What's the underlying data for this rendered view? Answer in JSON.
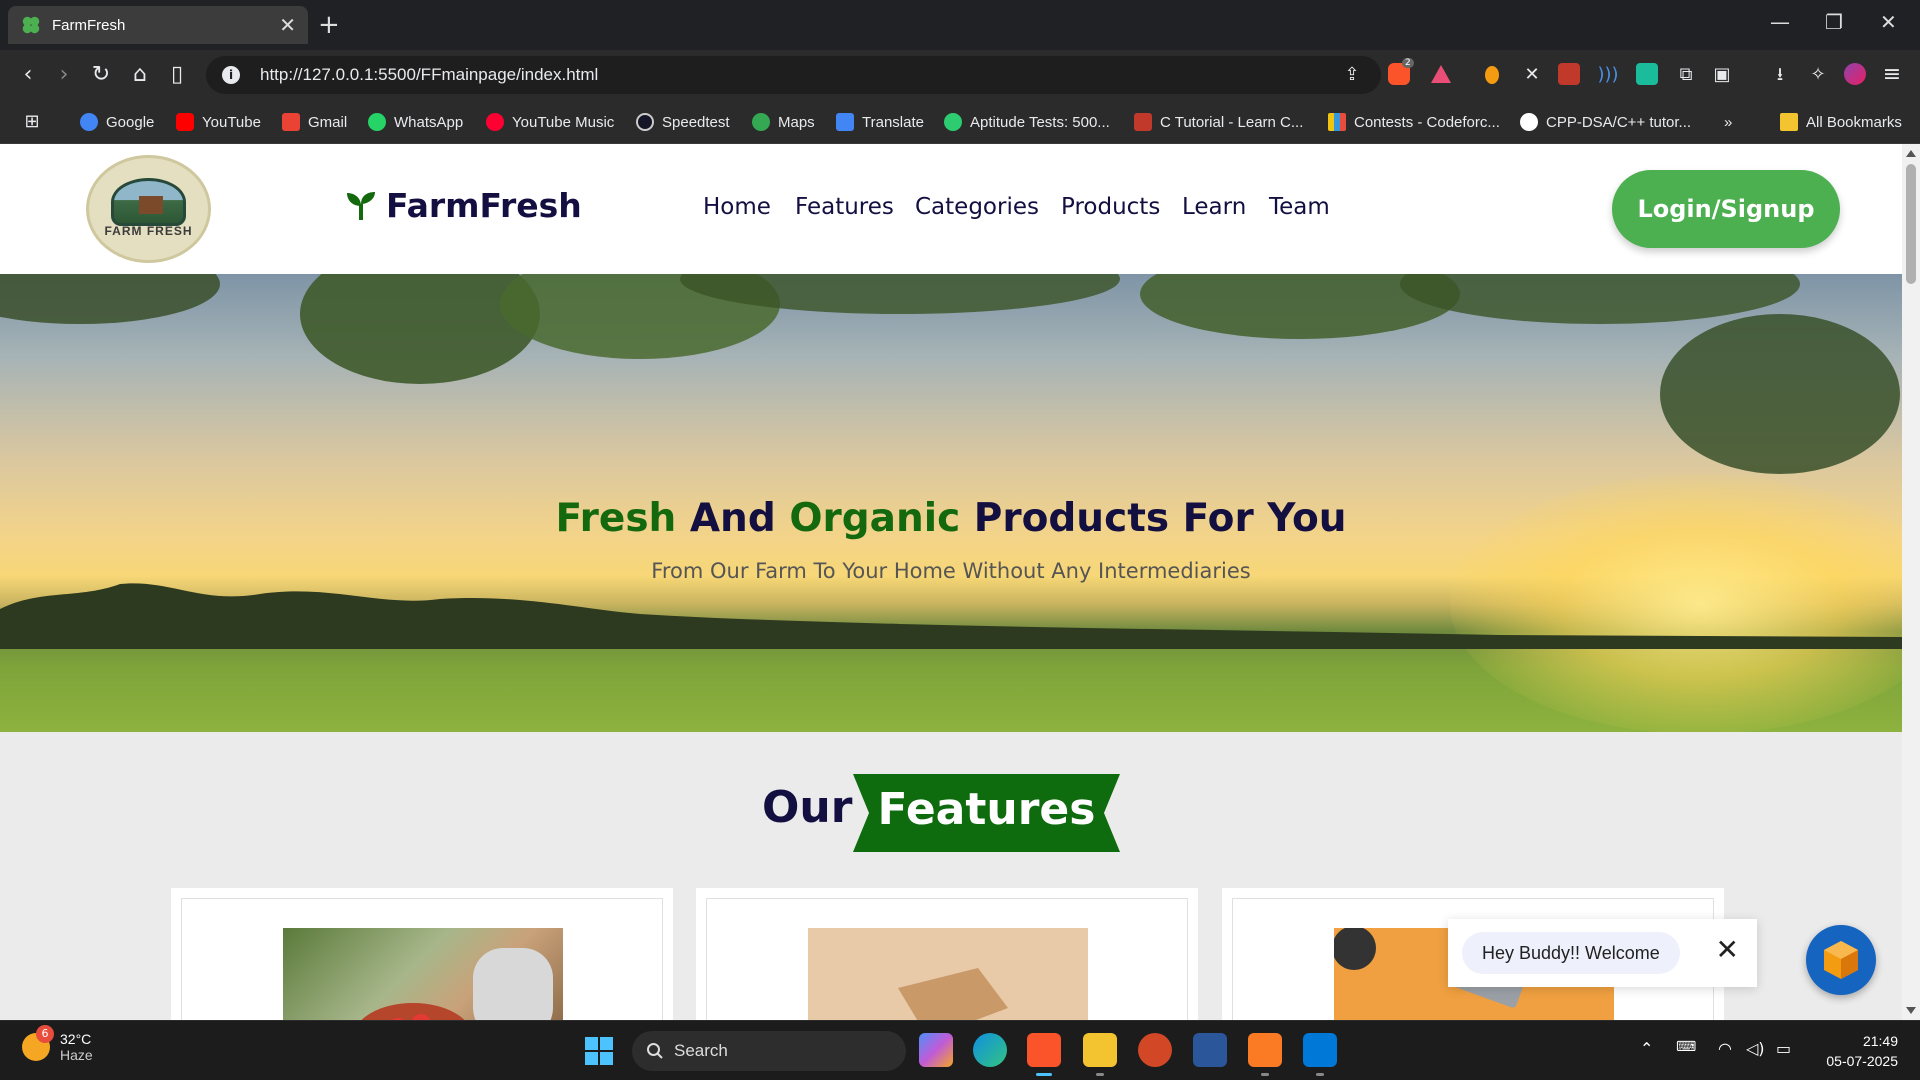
{
  "browser": {
    "tab_title": "FarmFresh",
    "url": "http://127.0.0.1:5500/FFmainpage/index.html",
    "brave_badge": "2",
    "bookmarks": [
      "Google",
      "YouTube",
      "Gmail",
      "WhatsApp",
      "YouTube Music",
      "Speedtest",
      "Maps",
      "Translate",
      "Aptitude Tests: 500...",
      "C Tutorial - Learn C...",
      "Contests - Codeforc...",
      "CPP-DSA/C++ tutor..."
    ],
    "more_bookmarks": "»",
    "all_bookmarks": "All Bookmarks"
  },
  "site": {
    "logo_text": "FARM FRESH",
    "brand": "FarmFresh",
    "nav": [
      "Home",
      "Features",
      "Categories",
      "Products",
      "Learn",
      "Team"
    ],
    "login_label": "Login/Signup",
    "hero": {
      "title_parts": [
        "Fresh",
        "And",
        "Organic",
        "Products For You"
      ],
      "subtitle": "From Our Farm To Your Home Without Any Intermediaries"
    },
    "features_heading": {
      "our": "Our",
      "features": "Features"
    },
    "toast": {
      "message": "Hey Buddy!! Welcome",
      "close": "✕"
    }
  },
  "taskbar": {
    "weather_temp": "32°C",
    "weather_desc": "Haze",
    "weather_badge": "6",
    "search_label": "Search",
    "time": "21:49",
    "date": "05-07-2025"
  },
  "colors": {
    "brand_green": "#14690f",
    "button_green": "#4caf50",
    "navy": "#130f40",
    "ribbon_green": "#0e6b0e"
  }
}
